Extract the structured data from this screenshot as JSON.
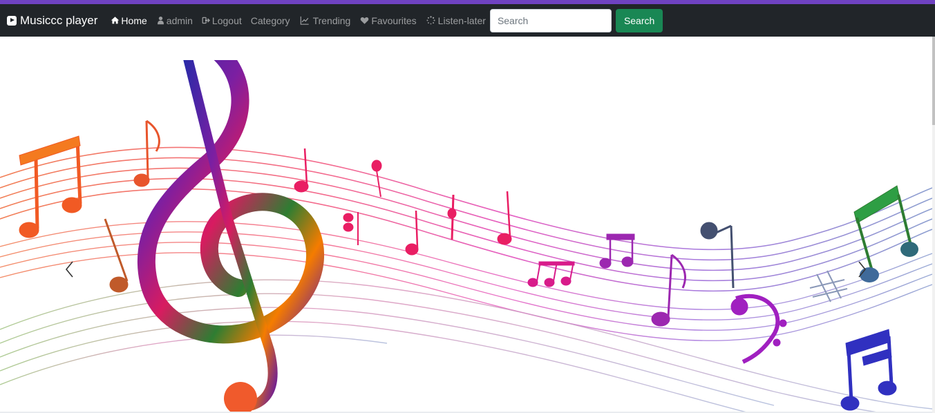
{
  "app": {
    "brand": "Musiccc player",
    "accent_color": "#6f42c1",
    "navbar_color": "#212529"
  },
  "nav": {
    "items": [
      {
        "label": "Home",
        "icon": "home-icon",
        "active": true
      },
      {
        "label": "admin",
        "icon": "user-icon",
        "active": false
      },
      {
        "label": "Logout",
        "icon": "logout-icon",
        "active": false
      },
      {
        "label": "Category",
        "icon": "",
        "active": false
      },
      {
        "label": "Trending",
        "icon": "trending-icon",
        "active": false
      },
      {
        "label": "Favourites",
        "icon": "heart-icon",
        "active": false
      },
      {
        "label": "Listen-later",
        "icon": "spinner-icon",
        "active": false
      }
    ]
  },
  "search": {
    "placeholder": "Search",
    "value": "",
    "button_label": "Search",
    "button_color": "#198754"
  },
  "carousel": {
    "slide_image": "music-notes-staff-banner",
    "prev_icon": "chevron-left-icon",
    "next_icon": "chevron-right-icon"
  }
}
